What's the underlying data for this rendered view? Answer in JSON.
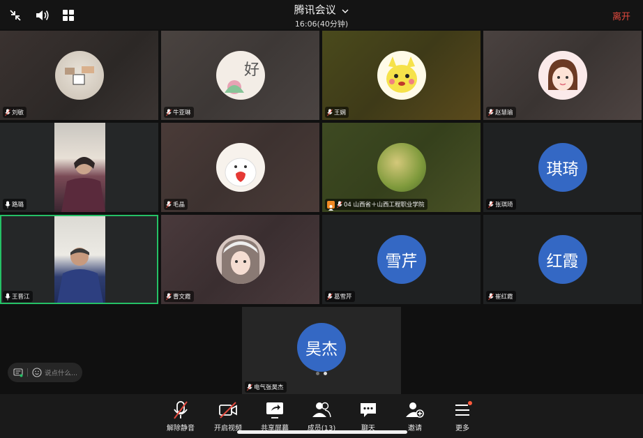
{
  "meeting": {
    "title": "腾讯会议",
    "time": "16:06(40分钟)",
    "leave_label": "离开"
  },
  "participants": [
    {
      "name": "刘敏"
    },
    {
      "name": "牛亚琳"
    },
    {
      "name": "王娴"
    },
    {
      "name": "赵慧瑜"
    },
    {
      "name": "路璐"
    },
    {
      "name": "毛晶"
    },
    {
      "name": "04 山西省＋山西工程职业学院"
    },
    {
      "name": "张琪琦",
      "avatar_text": "琪琦"
    },
    {
      "name": "王晋江"
    },
    {
      "name": "曹文霞"
    },
    {
      "name": "葛雪芹",
      "avatar_text": "雪芹"
    },
    {
      "name": "崔红霞",
      "avatar_text": "红霞"
    }
  ],
  "featured": {
    "name": "电气张昊杰",
    "avatar_text": "昊杰"
  },
  "chat": {
    "placeholder": "说点什么..."
  },
  "toolbar": {
    "unmute": "解除静音",
    "video": "开启视频",
    "share": "共享屏幕",
    "members": "成员(13)",
    "chat": "聊天",
    "invite": "邀请",
    "more": "更多"
  },
  "colors": {
    "accent": "#3468c4",
    "leave": "#e34a3e",
    "active_speaker": "#25c166",
    "badge": "#ff5a3c"
  }
}
